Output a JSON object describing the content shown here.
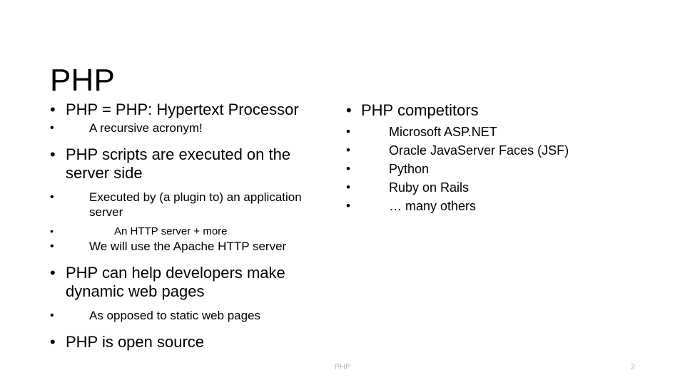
{
  "slide": {
    "title": "PHP",
    "bullet_glyph": "•",
    "background_color": "#ffffff",
    "text_color": "#000000",
    "footer_color": "#b8b8b8"
  },
  "left_column": {
    "items": [
      {
        "level": 1,
        "text": "PHP = PHP: Hypertext Processor"
      },
      {
        "level": 2,
        "text": "A recursive acronym!"
      },
      {
        "level": 1,
        "text": "PHP scripts are executed on the server side"
      },
      {
        "level": 2,
        "text": "Executed by (a plugin to) an application server"
      },
      {
        "level": 3,
        "text": "An HTTP server + more"
      },
      {
        "level": 2,
        "text": "We will use the Apache HTTP server"
      },
      {
        "level": 1,
        "text": "PHP can help developers make dynamic web pages"
      },
      {
        "level": 2,
        "text": "As opposed to static web pages"
      },
      {
        "level": 1,
        "text": "PHP is open source"
      }
    ]
  },
  "right_column": {
    "items": [
      {
        "level": 1,
        "text": "PHP competitors"
      },
      {
        "level": 2,
        "text": "Microsoft ASP.NET"
      },
      {
        "level": 2,
        "text": "Oracle JavaServer Faces (JSF)"
      },
      {
        "level": 2,
        "text": "Python"
      },
      {
        "level": 2,
        "text": "Ruby on Rails"
      },
      {
        "level": 2,
        "text": "… many others"
      }
    ]
  },
  "footer": {
    "title": "PHP",
    "page_number": "2"
  }
}
